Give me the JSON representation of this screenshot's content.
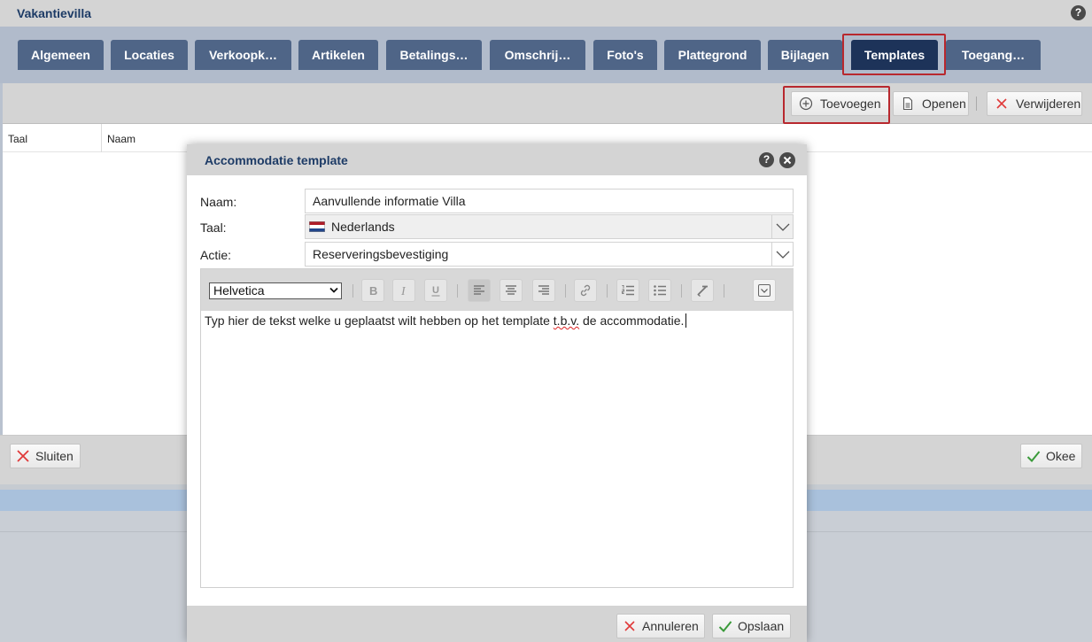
{
  "window": {
    "title": "Vakantievilla",
    "help": "?"
  },
  "tabs": [
    {
      "label": "Algemeen"
    },
    {
      "label": "Locaties"
    },
    {
      "label": "Verkoopk…"
    },
    {
      "label": "Artikelen"
    },
    {
      "label": "Betalings…"
    },
    {
      "label": "Omschrij…"
    },
    {
      "label": "Foto's"
    },
    {
      "label": "Plattegrond"
    },
    {
      "label": "Bijlagen"
    },
    {
      "label": "Templates"
    },
    {
      "label": "Toegang…"
    }
  ],
  "active_tab": "Templates",
  "toolbar": {
    "add_label": "Toevoegen",
    "open_label": "Openen",
    "delete_label": "Verwijderen"
  },
  "grid": {
    "columns": [
      "Taal",
      "Naam"
    ]
  },
  "footer": {
    "close_label": "Sluiten",
    "ok_label": "Okee"
  },
  "dialog": {
    "title": "Accommodatie template",
    "help": "?",
    "fields": {
      "naam_label": "Naam:",
      "naam_value": "Aanvullende informatie Villa",
      "taal_label": "Taal:",
      "taal_value": "Nederlands",
      "actie_label": "Actie:",
      "actie_value": "Reserveringsbevestiging"
    },
    "editor": {
      "font": "Helvetica",
      "text_before": "Typ hier de tekst welke u geplaatst wilt hebben op het template ",
      "text_misspelled": "t.b.v.",
      "text_after": " de accommodatie."
    },
    "cancel_label": "Annuleren",
    "save_label": "Opslaan"
  },
  "colors": {
    "tab": "#4f6587",
    "tab_active": "#1d3359",
    "highlight": "#b8282e",
    "title_text": "#1d3b66"
  }
}
